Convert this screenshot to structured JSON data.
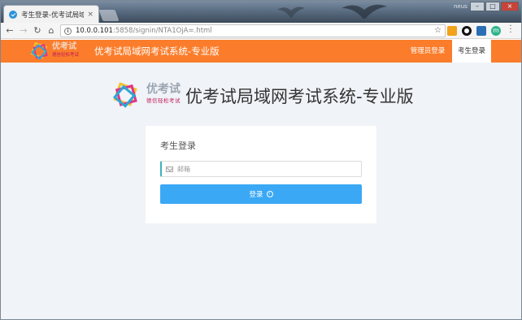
{
  "browser": {
    "tab_title": "考生登录-优考试局域网考",
    "tab_close": "×",
    "window_user": "neus",
    "window_buttons": {
      "minimize": "–",
      "maximize": "□",
      "close": "×"
    },
    "address": {
      "url_host": "10.0.0.101",
      "url_rest": ":5858/signin/NTA1OjA=.html",
      "star": "☆"
    },
    "nav": {
      "back": "←",
      "forward": "→",
      "reload": "↻",
      "home": "⌂"
    },
    "extensions": {
      "ext4_label": "m"
    }
  },
  "header": {
    "logo": {
      "line1": "优考试",
      "line2": "德信轻松考试"
    },
    "site_title": "优考试局域网考试系统-专业版",
    "links": {
      "admin_login": "管理员登录",
      "student_login": "考生登录"
    }
  },
  "main": {
    "brand": {
      "line1": "优考试",
      "line2": "德信轻松考试",
      "title": "优考试局域网考试系统-专业版"
    },
    "login_card": {
      "title": "考生登录",
      "email_placeholder": "邮箱",
      "email_value": "",
      "submit_label": "登录"
    }
  },
  "colors": {
    "header_bg": "#fb7d2b",
    "page_bg": "#f0f3f7",
    "button_bg": "#3aa8f5",
    "input_accent": "#3db2bc",
    "logo_accent": "#c2185b"
  },
  "icons": [
    "favicon-icon",
    "info-icon",
    "star-icon",
    "mail-icon",
    "arrow-circle-icon",
    "logo-icon"
  ]
}
